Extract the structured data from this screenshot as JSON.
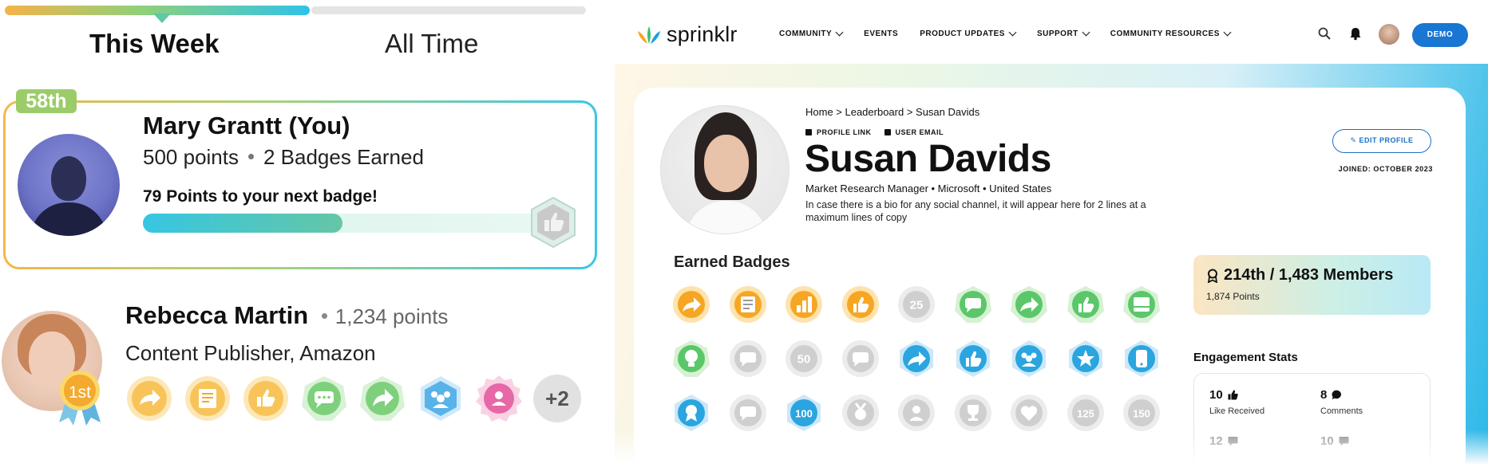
{
  "leaderboard": {
    "tabs": [
      {
        "label": "This Week",
        "active": true
      },
      {
        "label": "All Time",
        "active": false
      }
    ],
    "me": {
      "rank": "58th",
      "name": "Mary Grantt (You)",
      "points": "500 points",
      "badges_earned": "2 Badges Earned",
      "next_badge_text": "79 Points to your next badge!",
      "progress_fraction": 0.5
    },
    "entry": {
      "name": "Rebecca Martin",
      "points": "1,234 points",
      "role": "Content Publisher, Amazon",
      "place_label": "1st",
      "more_label": "+2",
      "badges": [
        "share-badge-icon",
        "notes-badge-icon",
        "thumbs-up-badge-icon",
        "chat-badge-icon",
        "forward-badge-icon",
        "team-badge-icon",
        "person-badge-icon"
      ]
    }
  },
  "profile": {
    "nav": {
      "logo_text": "sprinklr",
      "items": [
        {
          "label": "COMMUNITY",
          "dropdown": true
        },
        {
          "label": "EVENTS",
          "dropdown": false
        },
        {
          "label": "PRODUCT UPDATES",
          "dropdown": true
        },
        {
          "label": "SUPPORT",
          "dropdown": true
        },
        {
          "label": "COMMUNITY RESOURCES",
          "dropdown": true
        }
      ],
      "demo_label": "DEMO"
    },
    "breadcrumb": "Home > Leaderboard > Susan Davids",
    "profile_link": "PROFILE LINK",
    "user_email": "USER EMAIL",
    "name": "Susan Davids",
    "role_line": "Market Research Manager • Microsoft • United States",
    "bio": "In case there is a bio for any social channel, it will appear here for 2 lines at a maximum lines of copy",
    "edit_label": "EDIT PROFILE",
    "joined": "JOINED: OCTOBER 2023",
    "badges_title": "Earned Badges",
    "badges": [
      {
        "kind": "share",
        "color": "orange"
      },
      {
        "kind": "notes",
        "color": "orange"
      },
      {
        "kind": "chart",
        "color": "orange"
      },
      {
        "kind": "thumb",
        "color": "orange"
      },
      {
        "kind": "25",
        "color": "gray"
      },
      {
        "kind": "chat",
        "color": "green"
      },
      {
        "kind": "forward",
        "color": "green"
      },
      {
        "kind": "thumb",
        "color": "green"
      },
      {
        "kind": "inbox",
        "color": "green"
      },
      {
        "kind": "bulb",
        "color": "green"
      },
      {
        "kind": "chat",
        "color": "gray"
      },
      {
        "kind": "50",
        "color": "gray"
      },
      {
        "kind": "chat",
        "color": "gray"
      },
      {
        "kind": "forward",
        "color": "blue"
      },
      {
        "kind": "thumb",
        "color": "blue"
      },
      {
        "kind": "team",
        "color": "blue"
      },
      {
        "kind": "star",
        "color": "blue"
      },
      {
        "kind": "phone",
        "color": "blue"
      },
      {
        "kind": "award",
        "color": "blue"
      },
      {
        "kind": "chat",
        "color": "gray"
      },
      {
        "kind": "100",
        "color": "blue"
      },
      {
        "kind": "medal",
        "color": "gray"
      },
      {
        "kind": "person",
        "color": "gray"
      },
      {
        "kind": "trophy",
        "color": "gray"
      },
      {
        "kind": "heart",
        "color": "gray"
      },
      {
        "kind": "125",
        "color": "gray"
      },
      {
        "kind": "150",
        "color": "gray"
      }
    ],
    "rank": "214th / 1,483 Members",
    "rank_points": "1,874 Points",
    "engagement_title": "Engagement Stats",
    "stats": [
      {
        "value": "10",
        "label": "Like Received",
        "icon": "thumbs-up-icon"
      },
      {
        "value": "8",
        "label": "Comments",
        "icon": "comment-icon"
      },
      {
        "value": "12",
        "label": "",
        "icon": "message-icon"
      },
      {
        "value": "10",
        "label": "",
        "icon": "message-icon"
      }
    ]
  },
  "colors": {
    "brand_blue": "#1976d2",
    "rank_green": "#9ccc6a",
    "orange": "#f6a623",
    "green": "#5cc76a",
    "blue": "#2aa5e0",
    "gray": "#c8c8c8"
  }
}
